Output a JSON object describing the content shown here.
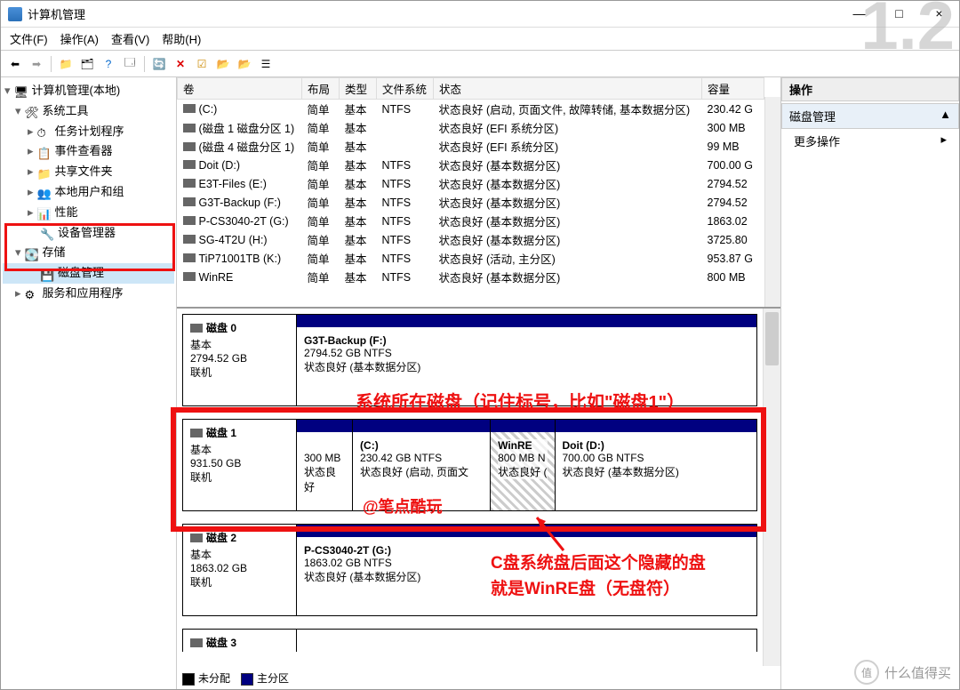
{
  "win": {
    "title": "计算机管理",
    "min": "—",
    "max": "□",
    "close": "×"
  },
  "menu": [
    "文件(F)",
    "操作(A)",
    "查看(V)",
    "帮助(H)"
  ],
  "tree": {
    "root": "计算机管理(本地)",
    "systools": "系统工具",
    "task": "任务计划程序",
    "event": "事件查看器",
    "share": "共享文件夹",
    "users": "本地用户和组",
    "perf": "性能",
    "devmgr": "设备管理器",
    "storage": "存储",
    "diskmgmt": "磁盘管理",
    "services": "服务和应用程序"
  },
  "cols": {
    "vol": "卷",
    "layout": "布局",
    "type": "类型",
    "fs": "文件系统",
    "status": "状态",
    "cap": "容量"
  },
  "vols": [
    {
      "n": "(C:)",
      "l": "简单",
      "t": "基本",
      "f": "NTFS",
      "s": "状态良好 (启动, 页面文件, 故障转储, 基本数据分区)",
      "c": "230.42 G"
    },
    {
      "n": "(磁盘 1 磁盘分区 1)",
      "l": "简单",
      "t": "基本",
      "f": "",
      "s": "状态良好 (EFI 系统分区)",
      "c": "300 MB"
    },
    {
      "n": "(磁盘 4 磁盘分区 1)",
      "l": "简单",
      "t": "基本",
      "f": "",
      "s": "状态良好 (EFI 系统分区)",
      "c": "99 MB"
    },
    {
      "n": "Doit (D:)",
      "l": "简单",
      "t": "基本",
      "f": "NTFS",
      "s": "状态良好 (基本数据分区)",
      "c": "700.00 G"
    },
    {
      "n": "E3T-Files (E:)",
      "l": "简单",
      "t": "基本",
      "f": "NTFS",
      "s": "状态良好 (基本数据分区)",
      "c": "2794.52"
    },
    {
      "n": "G3T-Backup (F:)",
      "l": "简单",
      "t": "基本",
      "f": "NTFS",
      "s": "状态良好 (基本数据分区)",
      "c": "2794.52"
    },
    {
      "n": "P-CS3040-2T (G:)",
      "l": "简单",
      "t": "基本",
      "f": "NTFS",
      "s": "状态良好 (基本数据分区)",
      "c": "1863.02"
    },
    {
      "n": "SG-4T2U (H:)",
      "l": "简单",
      "t": "基本",
      "f": "NTFS",
      "s": "状态良好 (基本数据分区)",
      "c": "3725.80"
    },
    {
      "n": "TiP71001TB (K:)",
      "l": "简单",
      "t": "基本",
      "f": "NTFS",
      "s": "状态良好 (活动, 主分区)",
      "c": "953.87 G"
    },
    {
      "n": "WinRE",
      "l": "简单",
      "t": "基本",
      "f": "NTFS",
      "s": "状态良好 (基本数据分区)",
      "c": "800 MB"
    }
  ],
  "disks": [
    {
      "name": "磁盘 0",
      "type": "基本",
      "size": "2794.52 GB",
      "status": "联机",
      "parts": [
        {
          "name": "G3T-Backup  (F:)",
          "l2": "2794.52 GB NTFS",
          "l3": "状态良好 (基本数据分区)",
          "w": "100%"
        }
      ]
    },
    {
      "name": "磁盘 1",
      "type": "基本",
      "size": "931.50 GB",
      "status": "联机",
      "parts": [
        {
          "name": "",
          "l2": "300 MB",
          "l3": "状态良好",
          "w": "12%"
        },
        {
          "name": "(C:)",
          "l2": "230.42 GB NTFS",
          "l3": "状态良好 (启动, 页面文",
          "w": "30%"
        },
        {
          "name": "WinRE",
          "l2": "800 MB N",
          "l3": "状态良好 (",
          "w": "14%",
          "hatch": true
        },
        {
          "name": "Doit  (D:)",
          "l2": "700.00 GB NTFS",
          "l3": "状态良好 (基本数据分区)",
          "w": "44%"
        }
      ]
    },
    {
      "name": "磁盘 2",
      "type": "基本",
      "size": "1863.02 GB",
      "status": "联机",
      "parts": [
        {
          "name": "P-CS3040-2T  (G:)",
          "l2": "1863.02 GB NTFS",
          "l3": "状态良好 (基本数据分区)",
          "w": "100%"
        }
      ]
    },
    {
      "name": "磁盘 3",
      "type": "",
      "size": "",
      "status": "",
      "parts": []
    }
  ],
  "legend": {
    "un": "未分配",
    "pri": "主分区"
  },
  "right": {
    "actions": "操作",
    "diskmgmt": "磁盘管理",
    "more": "更多操作",
    "caret": "▲",
    "arrow": "▸"
  },
  "anno": {
    "a1": "系统所在磁盘（记住标号，比如\"磁盘1\"）",
    "a2a": "C盘系统盘后面这个隐藏的盘",
    "a2b": "就是WinRE盘（无盘符）",
    "a3": "@笔点酷玩"
  },
  "big": "1.2",
  "wm": {
    "brand": "什么值得买",
    "mark": "值"
  }
}
